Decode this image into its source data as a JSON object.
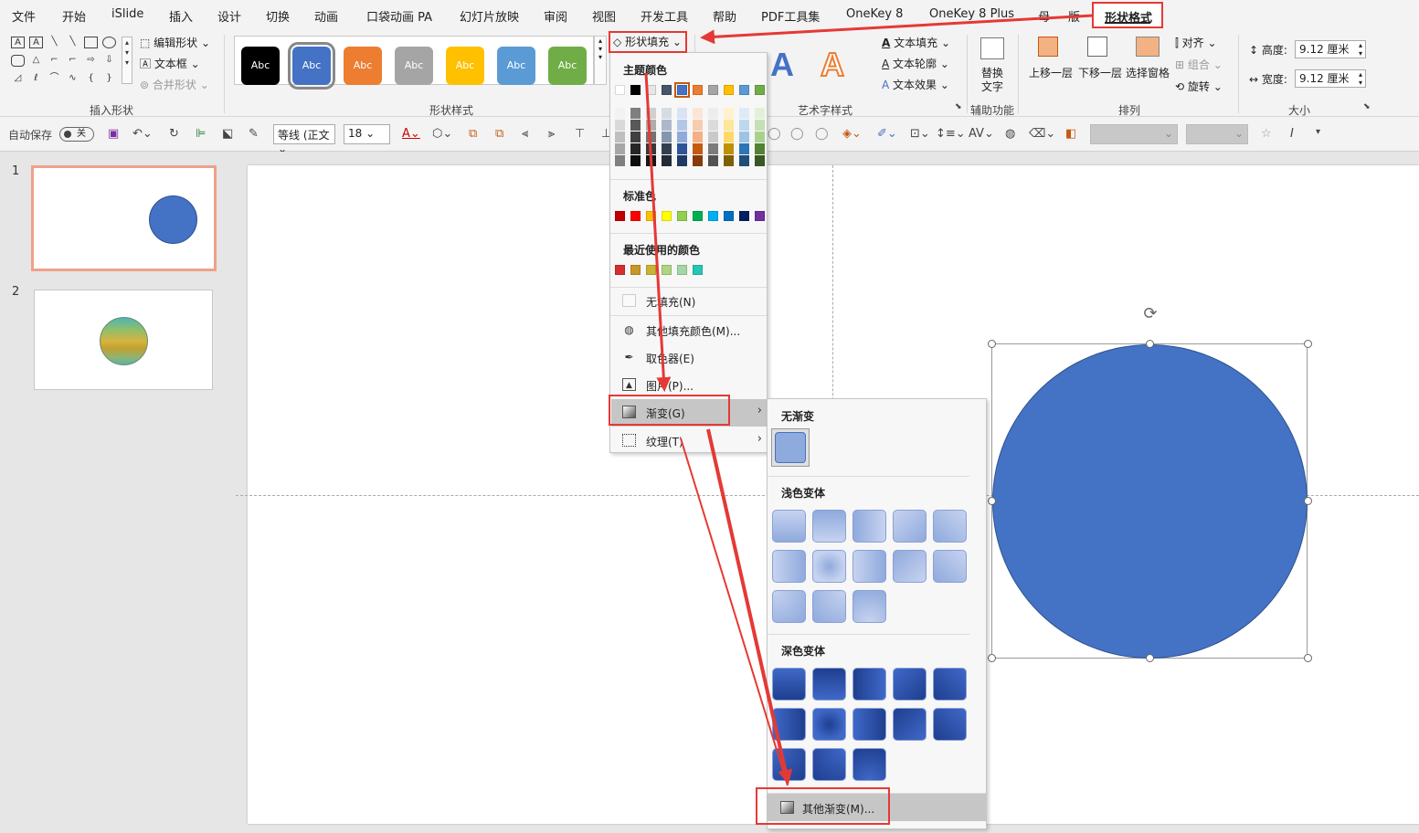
{
  "menubar": {
    "tabs": [
      "文件",
      "开始",
      "iSlide",
      "插入",
      "设计",
      "切换",
      "动画",
      "口袋动画 PA",
      "幻灯片放映",
      "审阅",
      "视图",
      "开发工具",
      "帮助",
      "PDF工具集",
      "OneKey 8",
      "OneKey 8 Plus",
      "母",
      "版"
    ],
    "active_tab": "形状格式"
  },
  "ribbon": {
    "insert_shapes": {
      "label": "插入形状",
      "edit_shape": "编辑形状",
      "text_box": "文本框",
      "merge_shapes": "合并形状"
    },
    "shape_styles": {
      "label": "形状样式",
      "swatches": [
        "Abc",
        "Abc",
        "Abc",
        "Abc",
        "Abc",
        "Abc",
        "Abc"
      ],
      "shape_fill": "形状填充"
    },
    "wordart": {
      "label": "艺术字样式",
      "text_fill": "文本填充",
      "text_outline": "文本轮廓",
      "text_effects": "文本效果"
    },
    "accessibility": {
      "label": "辅助功能",
      "alt_text_1": "替换",
      "alt_text_2": "文字"
    },
    "arrange": {
      "label": "排列",
      "bring_forward": "上移一层",
      "send_backward": "下移一层",
      "selection_pane": "选择窗格",
      "align": "对齐",
      "group": "组合",
      "rotate": "旋转"
    },
    "size": {
      "label": "大小",
      "height_label": "高度:",
      "height_value": "9.12 厘米",
      "width_label": "宽度:",
      "width_value": "9.12 厘米"
    }
  },
  "qat": {
    "autosave": "自动保存",
    "autosave_state": "关",
    "font_name": "等线 (正文",
    "font_size": "18"
  },
  "thumbnails": [
    {
      "num": "1"
    },
    {
      "num": "2"
    }
  ],
  "fill_menu": {
    "theme_colors": "主题颜色",
    "standard_colors": "标准色",
    "recent_colors": "最近使用的颜色",
    "no_fill": "无填充(N)",
    "more_colors": "其他填充颜色(M)...",
    "eyedropper": "取色器(E)",
    "picture": "图片(P)...",
    "gradient": "渐变(G)",
    "texture": "纹理(T)"
  },
  "gradient_menu": {
    "no_gradient": "无渐变",
    "light_variations": "浅色变体",
    "dark_variations": "深色变体",
    "more_gradients": "其他渐变(M)..."
  },
  "colors": {
    "accent_blue": "#4472c4",
    "highlight_red": "#e53935"
  }
}
